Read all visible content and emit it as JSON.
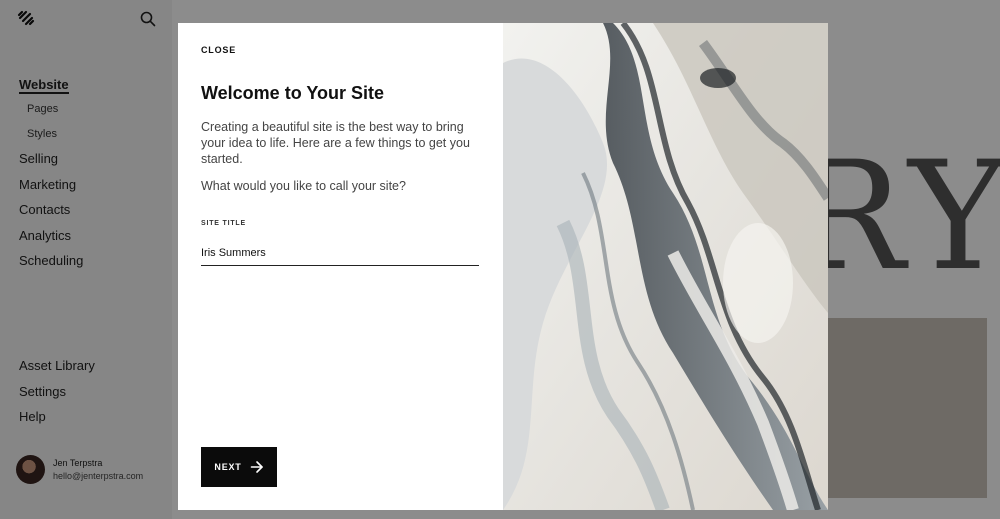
{
  "sidebar": {
    "logo_icon": "squarespace-logo-icon",
    "search_icon": "search-icon",
    "nav": {
      "website": "Website",
      "pages": "Pages",
      "styles": "Styles",
      "selling": "Selling",
      "marketing": "Marketing",
      "contacts": "Contacts",
      "analytics": "Analytics",
      "scheduling": "Scheduling"
    },
    "bottom": {
      "asset_library": "Asset Library",
      "settings": "Settings",
      "help": "Help"
    },
    "user": {
      "name": "Jen Terpstra",
      "email": "hello@jenterpstra.com"
    }
  },
  "preview": {
    "letters": "RY"
  },
  "modal": {
    "close_label": "CLOSE",
    "title": "Welcome to Your Site",
    "description": "Creating a beautiful site is the best way to bring your idea to life. Here are a few things to get you started.",
    "question": "What would you like to call your site?",
    "field_label": "SITE TITLE",
    "field_value": "Iris Summers",
    "next_label": "NEXT",
    "next_icon": "arrow-right-icon"
  },
  "colors": {
    "button_bg": "#0b0b0b",
    "sidebar_bg": "#f4f4f4"
  }
}
